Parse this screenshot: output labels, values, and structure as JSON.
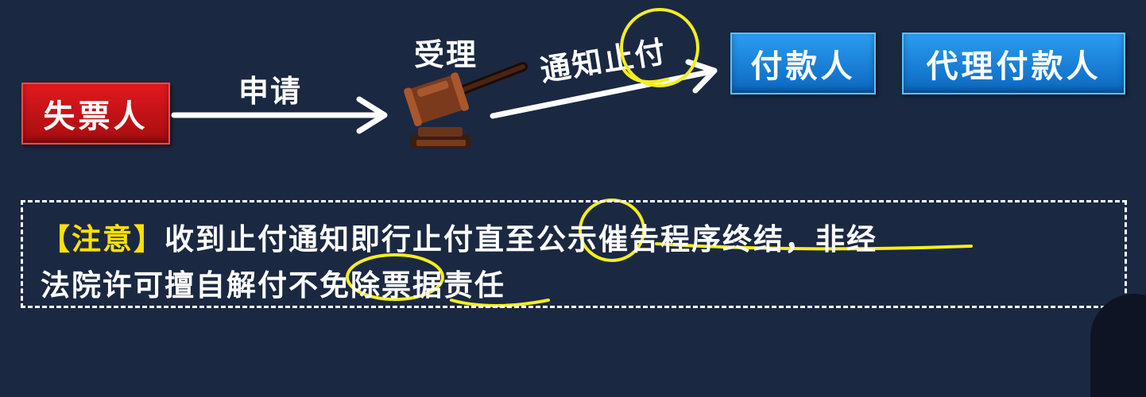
{
  "diagram": {
    "loser_box": "失票人",
    "apply_label": "申请",
    "accept_label": "受理",
    "notify_label": "通知止付",
    "payer_box": "付款人",
    "agent_payer_box": "代理付款人"
  },
  "note": {
    "tag": "【注意】",
    "line1": "收到止付通知即行止付直至公示催告程序终结，非经",
    "line2": "法院许可擅自解付不免除票据责任"
  },
  "colors": {
    "background": "#1b2842",
    "red_box": "#c8141a",
    "blue_box": "#1a84d8",
    "highlight": "#ffe000",
    "annotation": "#f5ee1e"
  },
  "icons": [
    "gavel-icon",
    "arrow-right-icon"
  ]
}
